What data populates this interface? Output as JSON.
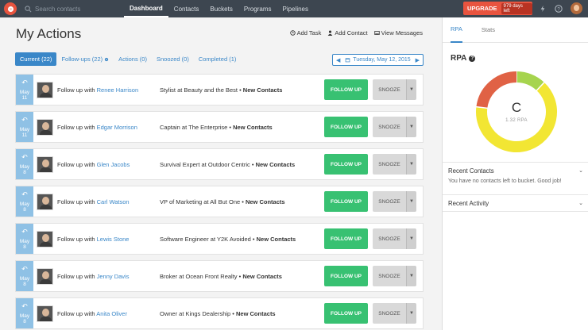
{
  "nav": {
    "search_placeholder": "Search contacts",
    "links": [
      "Dashboard",
      "Contacts",
      "Buckets",
      "Programs",
      "Pipelines"
    ],
    "upgrade_label": "UPGRADE",
    "days_left": "979 days left"
  },
  "page": {
    "title": "My Actions",
    "add_task": "Add Task",
    "add_contact": "Add Contact",
    "view_messages": "View Messages"
  },
  "tabs": {
    "current": "Current (22)",
    "followups": "Follow-ups (22)",
    "actions": "Actions (0)",
    "snoozed": "Snoozed (0)",
    "completed": "Completed (1)"
  },
  "date_picker": "Tuesday, May 12, 2015",
  "rows": [
    {
      "month": "May",
      "day": "11",
      "prefix": "Follow up with",
      "name": "Renee Harrison",
      "job": "Stylist at Beauty and the Best",
      "bucket": "New Contacts",
      "follow": "FOLLOW UP",
      "snooze": "SNOOZE"
    },
    {
      "month": "May",
      "day": "11",
      "prefix": "Follow up with",
      "name": "Edgar Morrison",
      "job": "Captain at The Enterprise",
      "bucket": "New Contacts",
      "follow": "FOLLOW UP",
      "snooze": "SNOOZE"
    },
    {
      "month": "May",
      "day": "8",
      "prefix": "Follow up with",
      "name": "Glen Jacobs",
      "job": "Survival Expert at Outdoor Centric",
      "bucket": "New Contacts",
      "follow": "FOLLOW UP",
      "snooze": "SNOOZE"
    },
    {
      "month": "May",
      "day": "8",
      "prefix": "Follow up with",
      "name": "Carl Watson",
      "job": "VP of Marketing at All But One",
      "bucket": "New Contacts",
      "follow": "FOLLOW UP",
      "snooze": "SNOOZE"
    },
    {
      "month": "May",
      "day": "8",
      "prefix": "Follow up with",
      "name": "Lewis Stone",
      "job": "Software Engineer at Y2K Avoided",
      "bucket": "New Contacts",
      "follow": "FOLLOW UP",
      "snooze": "SNOOZE"
    },
    {
      "month": "May",
      "day": "8",
      "prefix": "Follow up with",
      "name": "Jenny Davis",
      "job": "Broker at Ocean Front Realty",
      "bucket": "New Contacts",
      "follow": "FOLLOW UP",
      "snooze": "SNOOZE"
    },
    {
      "month": "May",
      "day": "8",
      "prefix": "Follow up with",
      "name": "Anita Oliver",
      "job": "Owner at Kings Dealership",
      "bucket": "New Contacts",
      "follow": "FOLLOW UP",
      "snooze": "SNOOZE"
    }
  ],
  "side": {
    "tab_rpa": "RPA",
    "tab_stats": "Stats",
    "rpa_title": "RPA",
    "grade": "C",
    "rpa_value": "1.32 RPA",
    "recent_contacts": "Recent Contacts",
    "recent_contacts_msg": "You have no contacts left to bucket. Good job!",
    "recent_activity": "Recent Activity"
  },
  "colors": {
    "nav_bg": "#3d4650",
    "accent": "#3a87c8",
    "upgrade": "#e8543f",
    "follow_btn": "#38c172",
    "donut_red": "#e06245",
    "donut_green": "#a6d44e",
    "donut_yellow": "#f2e633"
  },
  "donut": {
    "segments": [
      {
        "label": "green",
        "fraction": 0.12
      },
      {
        "label": "yellow",
        "fraction": 0.65
      },
      {
        "label": "red",
        "fraction": 0.23
      }
    ]
  }
}
